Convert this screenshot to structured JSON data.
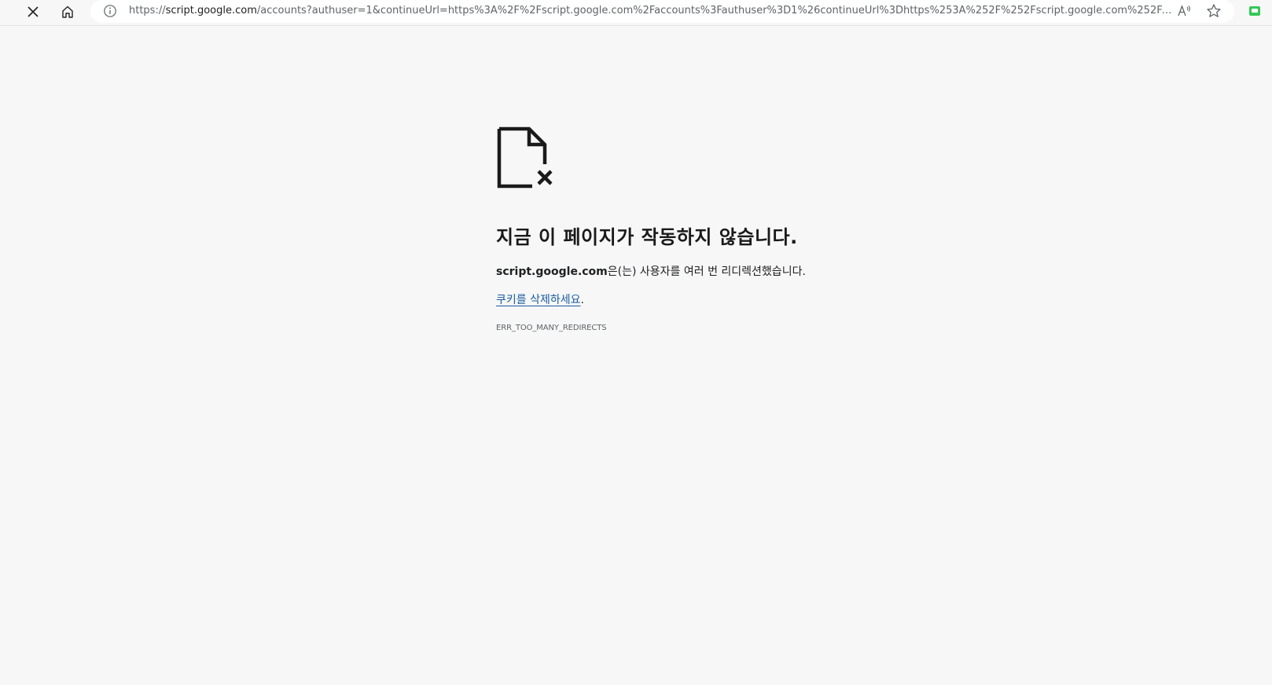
{
  "browser": {
    "url_prefix": "https://",
    "url_host": "script.google.com",
    "url_rest": "/accounts?authuser=1&continueUrl=https%3A%2F%2Fscript.google.com%2Faccounts%3Fauthuser%3D1%26continueUrl%3Dhttps%253A%252F%252Fscript.google.com%252Faccounts%2...",
    "icons": {
      "stop": "close-icon",
      "home": "home-icon",
      "site_info": "info-icon",
      "read_aloud": "read-aloud-icon",
      "favorite": "star-icon",
      "extension": "extension-icon"
    }
  },
  "error_page": {
    "title": "지금 이 페이지가 작동하지 않습니다.",
    "host": "script.google.com",
    "description": "은(는) 사용자를 여러 번 리디렉션했습니다.",
    "link_text": "쿠키를 삭제하세요",
    "link_suffix": ".",
    "error_code": "ERR_TOO_MANY_REDIRECTS"
  },
  "colors": {
    "background": "#f7f7f7",
    "link": "#1a5c9e",
    "extension_green": "#34c759"
  }
}
